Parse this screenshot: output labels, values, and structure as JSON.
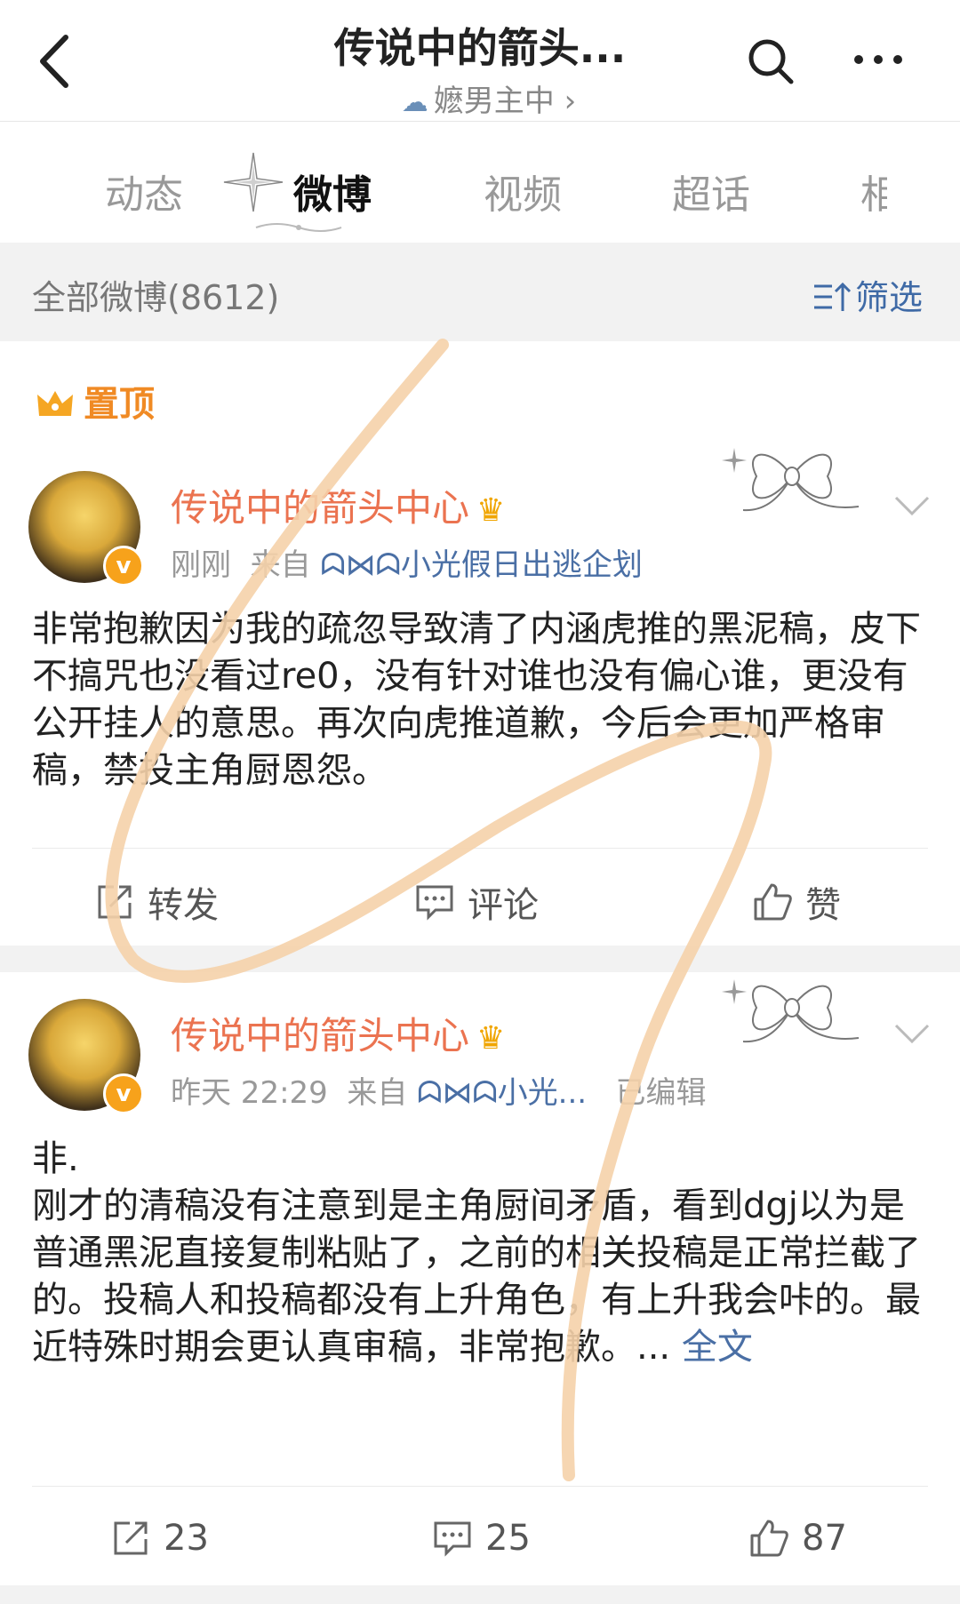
{
  "header": {
    "title": "传说中的箭头...",
    "subtitle": "嬷男主中",
    "subtitle_chevron": "›"
  },
  "tabs": [
    "动态",
    "微博",
    "视频",
    "超话",
    "相"
  ],
  "filter": {
    "count_label": "全部微博(8612)",
    "filter_label": "筛选"
  },
  "posts": [
    {
      "pinned_label": "置顶",
      "author": "传说中的箭头中心",
      "time": "刚刚",
      "from_label": "来自",
      "source": "ᗣ⋈ᗣ小光假日出逃企划",
      "edited": "",
      "text": "非常抱歉因为我的疏忽导致清了内涵虎推的黑泥稿，皮下不搞咒也没看过re0，没有针对谁也没有偏心谁，更没有公开挂人的意思。再次向虎推道歉，今后会更加严格审稿，禁投主角厨恩怨。",
      "more": "",
      "actions": {
        "repost": "转发",
        "comment": "评论",
        "like": "赞"
      }
    },
    {
      "pinned_label": "",
      "author": "传说中的箭头中心",
      "time": "昨天 22:29",
      "from_label": "来自",
      "source": "ᗣ⋈ᗣ小光...",
      "edited": "已编辑",
      "text": "非.\n刚才的清稿没有注意到是主角厨间矛盾，看到dgj以为是普通黑泥直接复制粘贴了，之前的相关投稿是正常拦截了的。投稿人和投稿都没有上升角色，有上升我会咔的。最近特殊时期会更认真审稿，非常抱歉。...",
      "more": "全文",
      "actions": {
        "repost": "23",
        "comment": "25",
        "like": "87"
      }
    }
  ],
  "colors": {
    "accent_orange": "#eb7350",
    "link_blue": "#4a6fa5",
    "pin_orange": "#f08a24",
    "annotation_stroke": "#f5d2aa"
  },
  "icons": [
    "back-icon",
    "search-icon",
    "more-icon",
    "filter-icon",
    "crown-icon",
    "verified-icon",
    "vip-crown-icon",
    "chevron-down-icon",
    "repost-icon",
    "comment-icon",
    "like-icon",
    "bow-decoration-icon",
    "sparkle-star-icon"
  ]
}
